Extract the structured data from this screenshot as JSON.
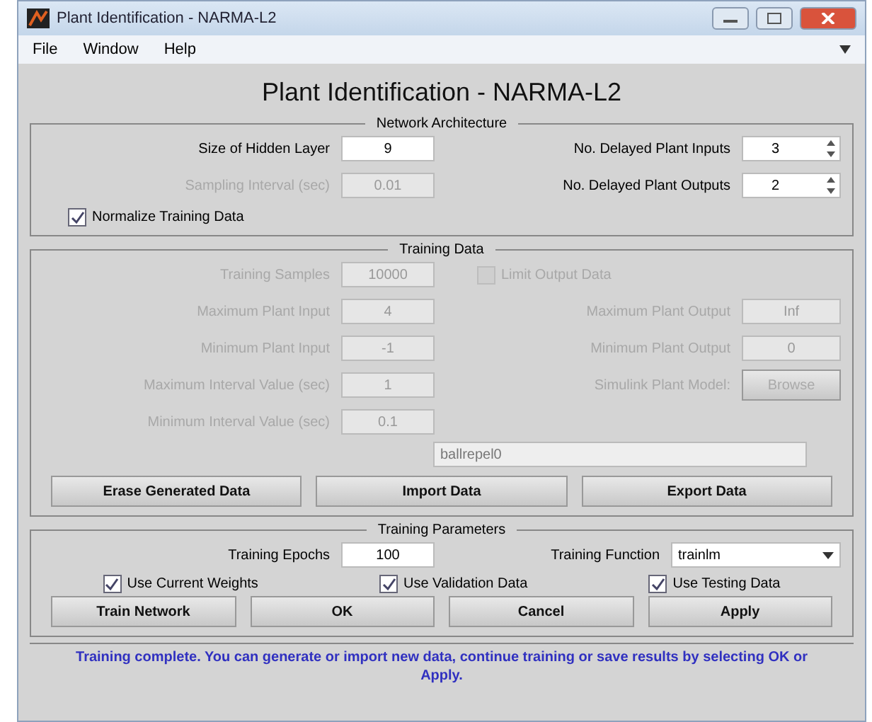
{
  "window": {
    "title": "Plant Identification - NARMA-L2"
  },
  "menu": [
    "File",
    "Window",
    "Help"
  ],
  "heading": "Plant Identification - NARMA-L2",
  "network_architecture": {
    "title": "Network Architecture",
    "left": [
      {
        "label": "Size of Hidden Layer",
        "value": "9",
        "disabled": false
      },
      {
        "label": "Sampling Interval (sec)",
        "value": "0.01",
        "disabled": true
      }
    ],
    "right": [
      {
        "label": "No. Delayed Plant Inputs",
        "value": "3"
      },
      {
        "label": "No. Delayed Plant Outputs",
        "value": "2"
      }
    ],
    "normalize": {
      "label": "Normalize Training Data",
      "checked": true
    }
  },
  "training_data": {
    "title": "Training Data",
    "left": [
      {
        "label": "Training Samples",
        "value": "10000",
        "disabled": true
      },
      {
        "label": "Maximum Plant Input",
        "value": "4",
        "disabled": true
      },
      {
        "label": "Minimum Plant Input",
        "value": "-1",
        "disabled": true
      },
      {
        "label": "Maximum Interval Value (sec)",
        "value": "1",
        "disabled": true
      },
      {
        "label": "Minimum Interval Value (sec)",
        "value": "0.1",
        "disabled": true
      }
    ],
    "limit_output": {
      "label": "Limit Output Data",
      "checked": false,
      "disabled": true
    },
    "right": [
      {
        "label": "Maximum Plant Output",
        "value": "Inf",
        "disabled": true
      },
      {
        "label": "Minimum Plant Output",
        "value": "0",
        "disabled": true
      }
    ],
    "model_label": "Simulink Plant Model:",
    "browse": "Browse",
    "model": "ballrepel0",
    "buttons": [
      "Erase Generated Data",
      "Import Data",
      "Export Data"
    ]
  },
  "training_parameters": {
    "title": "Training Parameters",
    "epochs": {
      "label": "Training Epochs",
      "value": "100"
    },
    "function": {
      "label": "Training Function",
      "value": "trainlm"
    },
    "checks": [
      {
        "label": "Use Current Weights",
        "checked": true
      },
      {
        "label": "Use Validation Data",
        "checked": true
      },
      {
        "label": "Use Testing Data",
        "checked": true
      }
    ],
    "buttons": [
      "Train Network",
      "OK",
      "Cancel",
      "Apply"
    ]
  },
  "status": "Training complete. You can generate or import new data, continue training or save results by selecting OK or Apply."
}
